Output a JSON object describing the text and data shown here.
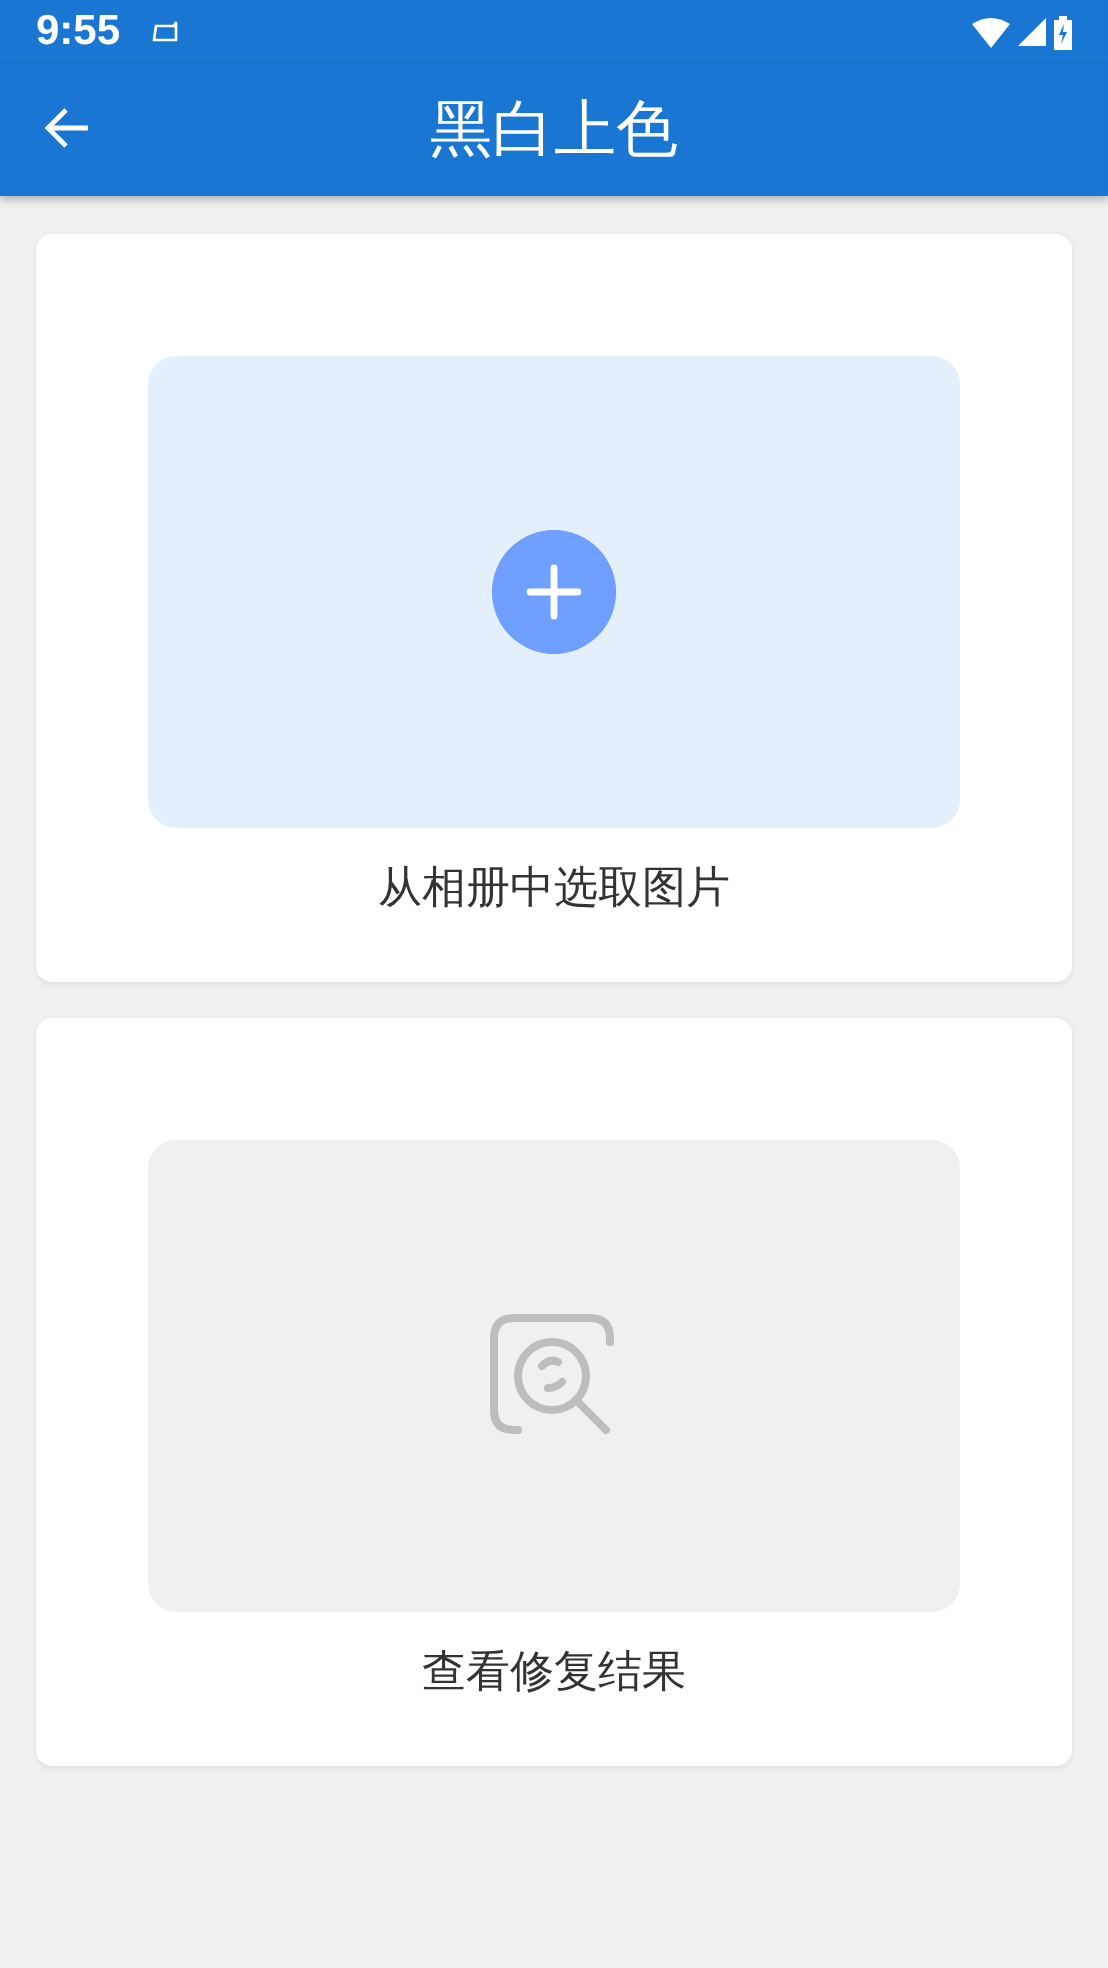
{
  "status_bar": {
    "time": "9:55"
  },
  "app_bar": {
    "title": "黑白上色"
  },
  "cards": [
    {
      "kind": "add",
      "label": "从相册中选取图片"
    },
    {
      "kind": "view",
      "label": "查看修复结果"
    }
  ]
}
